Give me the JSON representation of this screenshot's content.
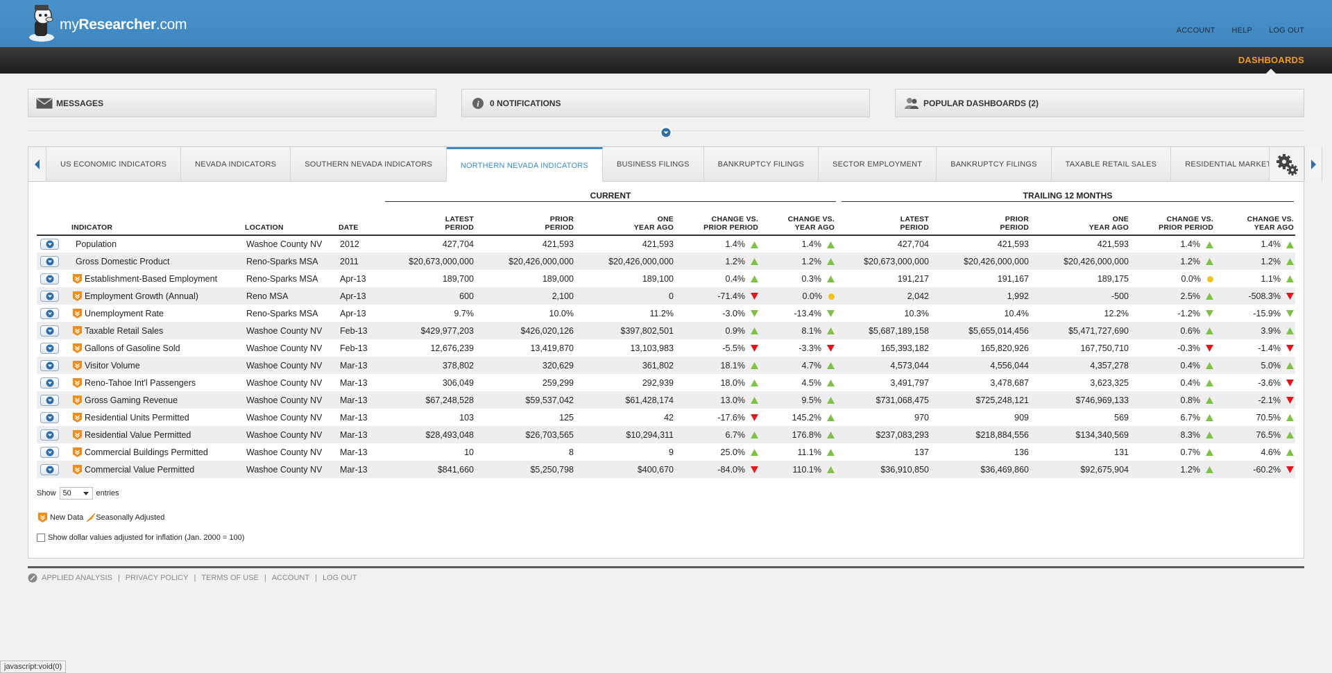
{
  "header": {
    "logo_prefix": "my",
    "logo_bold": "Researcher",
    "logo_suffix": ".com",
    "links": [
      "ACCOUNT",
      "HELP",
      "LOG OUT"
    ],
    "dashboards_label": "DASHBOARDS",
    "accent_color": "#f39a21"
  },
  "panels": {
    "messages": "MESSAGES",
    "notifications": "0 NOTIFICATIONS",
    "popular": "POPULAR DASHBOARDS (2)"
  },
  "tabs": [
    "US ECONOMIC INDICATORS",
    "NEVADA INDICATORS",
    "SOUTHERN NEVADA INDICATORS",
    "NORTHERN NEVADA INDICATORS",
    "BUSINESS FILINGS",
    "BANKRUPTCY FILINGS",
    "SECTOR EMPLOYMENT",
    "BANKRUPTCY FILINGS",
    "TAXABLE RETAIL SALES",
    "RESIDENTIAL MARKET INDICATORS"
  ],
  "active_tab_index": 3,
  "table": {
    "group_current": "CURRENT",
    "group_trailing": "TRAILING 12 MONTHS",
    "headers": {
      "indicator": "INDICATOR",
      "location": "LOCATION",
      "date": "DATE",
      "latest_1": "LATEST",
      "latest_2": "PERIOD",
      "prior_1": "PRIOR",
      "prior_2": "PERIOD",
      "one_1": "ONE",
      "one_2": "YEAR AGO",
      "cvp_1": "CHANGE VS.",
      "cvp_2": "PRIOR PERIOD",
      "cvy_1": "CHANGE VS.",
      "cvy_2": "YEAR AGO"
    },
    "rows": [
      {
        "indicator": "Population",
        "new": false,
        "location": "Washoe County NV",
        "date": "2012",
        "cur": [
          "427,704",
          "421,593",
          "421,593",
          "1.4%",
          "1.4%"
        ],
        "cur_t": [
          "up",
          "up"
        ],
        "trl": [
          "427,704",
          "421,593",
          "421,593",
          "1.4%",
          "1.4%"
        ],
        "trl_t": [
          "up",
          "up"
        ]
      },
      {
        "indicator": "Gross Domestic Product",
        "new": false,
        "location": "Reno-Sparks MSA",
        "date": "2011",
        "cur": [
          "$20,673,000,000",
          "$20,426,000,000",
          "$20,426,000,000",
          "1.2%",
          "1.2%"
        ],
        "cur_t": [
          "up",
          "up"
        ],
        "trl": [
          "$20,673,000,000",
          "$20,426,000,000",
          "$20,426,000,000",
          "1.2%",
          "1.2%"
        ],
        "trl_t": [
          "up",
          "up"
        ]
      },
      {
        "indicator": "Establishment-Based Employment",
        "new": true,
        "location": "Reno-Sparks MSA",
        "date": "Apr-13",
        "cur": [
          "189,700",
          "189,000",
          "189,100",
          "0.4%",
          "0.3%"
        ],
        "cur_t": [
          "up",
          "up"
        ],
        "trl": [
          "191,217",
          "191,167",
          "189,175",
          "0.0%",
          "1.1%"
        ],
        "trl_t": [
          "flat",
          "up"
        ]
      },
      {
        "indicator": "Employment Growth (Annual)",
        "new": true,
        "location": "Reno MSA",
        "date": "Apr-13",
        "cur": [
          "600",
          "2,100",
          "0",
          "-71.4%",
          "0.0%"
        ],
        "cur_t": [
          "down",
          "flat"
        ],
        "trl": [
          "2,042",
          "1,992",
          "-500",
          "2.5%",
          "-508.3%"
        ],
        "trl_t": [
          "up",
          "down"
        ]
      },
      {
        "indicator": "Unemployment Rate",
        "new": true,
        "location": "Reno-Sparks MSA",
        "date": "Apr-13",
        "cur": [
          "9.7%",
          "10.0%",
          "11.2%",
          "-3.0%",
          "-13.4%"
        ],
        "cur_t": [
          "good-down",
          "good-down"
        ],
        "trl": [
          "10.3%",
          "10.4%",
          "12.2%",
          "-1.2%",
          "-15.9%"
        ],
        "trl_t": [
          "good-down",
          "good-down"
        ]
      },
      {
        "indicator": "Taxable Retail Sales",
        "new": true,
        "location": "Washoe County NV",
        "date": "Feb-13",
        "cur": [
          "$429,977,203",
          "$426,020,126",
          "$397,802,501",
          "0.9%",
          "8.1%"
        ],
        "cur_t": [
          "up",
          "up"
        ],
        "trl": [
          "$5,687,189,158",
          "$5,655,014,456",
          "$5,471,727,690",
          "0.6%",
          "3.9%"
        ],
        "trl_t": [
          "up",
          "up"
        ]
      },
      {
        "indicator": "Gallons of Gasoline Sold",
        "new": true,
        "location": "Washoe County NV",
        "date": "Feb-13",
        "cur": [
          "12,676,239",
          "13,419,870",
          "13,103,983",
          "-5.5%",
          "-3.3%"
        ],
        "cur_t": [
          "down",
          "down"
        ],
        "trl": [
          "165,393,182",
          "165,820,926",
          "167,750,710",
          "-0.3%",
          "-1.4%"
        ],
        "trl_t": [
          "down",
          "down"
        ]
      },
      {
        "indicator": "Visitor Volume",
        "new": true,
        "location": "Washoe County NV",
        "date": "Mar-13",
        "cur": [
          "378,802",
          "320,629",
          "361,802",
          "18.1%",
          "4.7%"
        ],
        "cur_t": [
          "up",
          "up"
        ],
        "trl": [
          "4,573,044",
          "4,556,044",
          "4,357,278",
          "0.4%",
          "5.0%"
        ],
        "trl_t": [
          "up",
          "up"
        ]
      },
      {
        "indicator": "Reno-Tahoe Int'l Passengers",
        "new": true,
        "location": "Washoe County NV",
        "date": "Mar-13",
        "cur": [
          "306,049",
          "259,299",
          "292,939",
          "18.0%",
          "4.5%"
        ],
        "cur_t": [
          "up",
          "up"
        ],
        "trl": [
          "3,491,797",
          "3,478,687",
          "3,623,325",
          "0.4%",
          "-3.6%"
        ],
        "trl_t": [
          "up",
          "down"
        ]
      },
      {
        "indicator": "Gross Gaming Revenue",
        "new": true,
        "location": "Washoe County NV",
        "date": "Mar-13",
        "cur": [
          "$67,248,528",
          "$59,537,042",
          "$61,428,174",
          "13.0%",
          "9.5%"
        ],
        "cur_t": [
          "up",
          "up"
        ],
        "trl": [
          "$731,068,475",
          "$725,248,121",
          "$746,969,133",
          "0.8%",
          "-2.1%"
        ],
        "trl_t": [
          "up",
          "down"
        ]
      },
      {
        "indicator": "Residential Units Permitted",
        "new": true,
        "location": "Washoe County NV",
        "date": "Mar-13",
        "cur": [
          "103",
          "125",
          "42",
          "-17.6%",
          "145.2%"
        ],
        "cur_t": [
          "down",
          "up"
        ],
        "trl": [
          "970",
          "909",
          "569",
          "6.7%",
          "70.5%"
        ],
        "trl_t": [
          "up",
          "up"
        ]
      },
      {
        "indicator": "Residential Value Permitted",
        "new": true,
        "location": "Washoe County NV",
        "date": "Mar-13",
        "cur": [
          "$28,493,048",
          "$26,703,565",
          "$10,294,311",
          "6.7%",
          "176.8%"
        ],
        "cur_t": [
          "up",
          "up"
        ],
        "trl": [
          "$237,083,293",
          "$218,884,556",
          "$134,340,569",
          "8.3%",
          "76.5%"
        ],
        "trl_t": [
          "up",
          "up"
        ]
      },
      {
        "indicator": "Commercial Buildings Permitted",
        "new": true,
        "location": "Washoe County NV",
        "date": "Mar-13",
        "cur": [
          "10",
          "8",
          "9",
          "25.0%",
          "11.1%"
        ],
        "cur_t": [
          "up",
          "up"
        ],
        "trl": [
          "137",
          "136",
          "131",
          "0.7%",
          "4.6%"
        ],
        "trl_t": [
          "up",
          "up"
        ]
      },
      {
        "indicator": "Commercial Value Permitted",
        "new": true,
        "location": "Washoe County NV",
        "date": "Mar-13",
        "cur": [
          "$841,660",
          "$5,250,798",
          "$400,670",
          "-84.0%",
          "110.1%"
        ],
        "cur_t": [
          "down",
          "up"
        ],
        "trl": [
          "$36,910,850",
          "$36,469,860",
          "$92,675,904",
          "1.2%",
          "-60.2%"
        ],
        "trl_t": [
          "up",
          "down"
        ]
      }
    ]
  },
  "colors": {
    "up": "#7dc242",
    "down": "#e8141b",
    "flat": "#f2c21e",
    "accent": "#3b8ac6"
  },
  "controls": {
    "show_label": "Show",
    "entries_value": "50",
    "entries_label": "entries",
    "legend_new": "New Data",
    "legend_seasonal": "Seasonally Adjusted",
    "inflation_label": "Show dollar values adjusted for inflation (Jan. 2000 = 100)"
  },
  "footer": {
    "links": [
      "APPLIED ANALYSIS",
      "PRIVACY POLICY",
      "TERMS OF USE",
      "ACCOUNT",
      "LOG OUT"
    ]
  },
  "status_bar": "javascript:void(0)"
}
